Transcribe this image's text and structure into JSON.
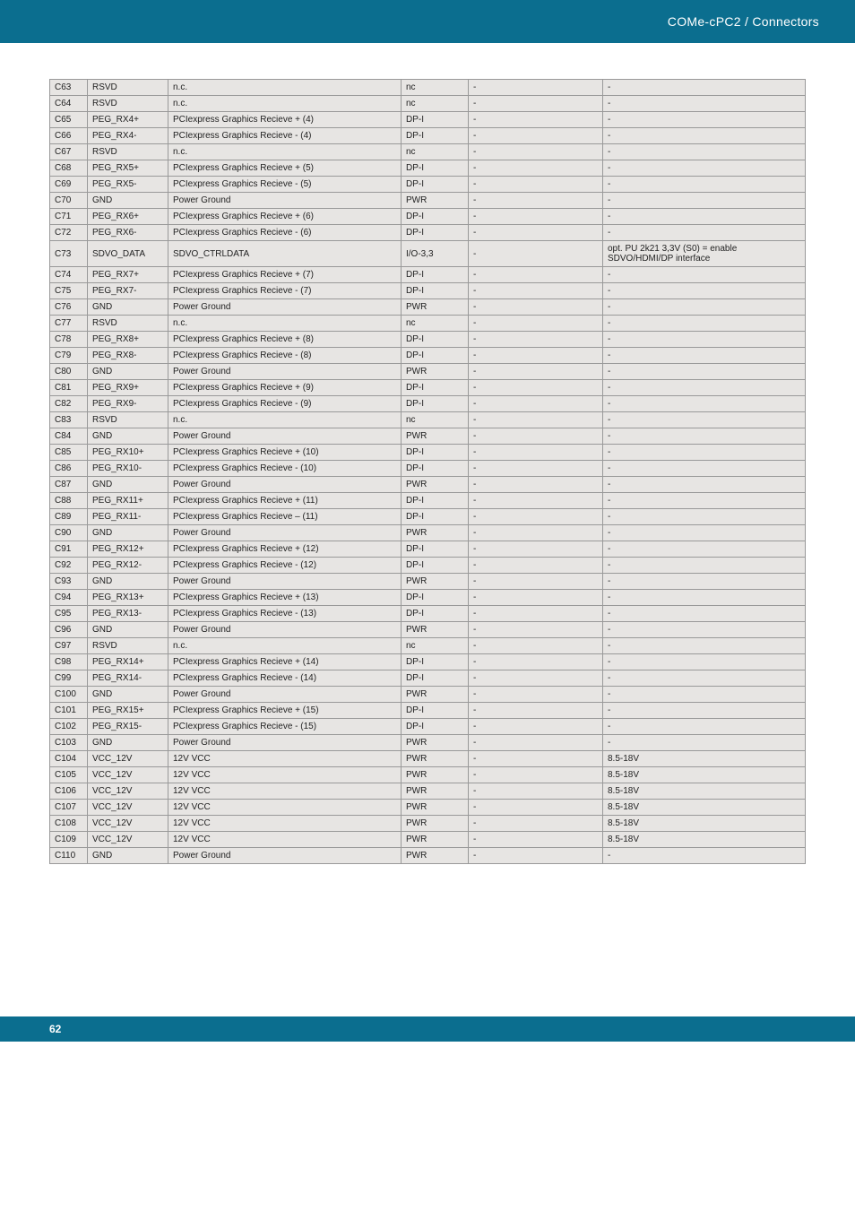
{
  "header": {
    "breadcrumb": "COMe-cPC2 / Connectors"
  },
  "footer": {
    "page": "62"
  },
  "table": {
    "rows": [
      {
        "pin": "C63",
        "signal": "RSVD",
        "desc": "n.c.",
        "type": "nc",
        "col5": "-",
        "col6": "-"
      },
      {
        "pin": "C64",
        "signal": "RSVD",
        "desc": "n.c.",
        "type": "nc",
        "col5": "-",
        "col6": "-"
      },
      {
        "pin": "C65",
        "signal": "PEG_RX4+",
        "desc": "PCIexpress Graphics Recieve + (4)",
        "type": "DP-I",
        "col5": "-",
        "col6": "-"
      },
      {
        "pin": "C66",
        "signal": "PEG_RX4-",
        "desc": "PCIexpress Graphics Recieve - (4)",
        "type": "DP-I",
        "col5": "-",
        "col6": "-"
      },
      {
        "pin": "C67",
        "signal": "RSVD",
        "desc": "n.c.",
        "type": "nc",
        "col5": "-",
        "col6": "-"
      },
      {
        "pin": "C68",
        "signal": "PEG_RX5+",
        "desc": "PCIexpress Graphics Recieve + (5)",
        "type": "DP-I",
        "col5": "-",
        "col6": "-"
      },
      {
        "pin": "C69",
        "signal": "PEG_RX5-",
        "desc": "PCIexpress Graphics Recieve - (5)",
        "type": "DP-I",
        "col5": "-",
        "col6": "-"
      },
      {
        "pin": "C70",
        "signal": "GND",
        "desc": "Power Ground",
        "type": "PWR",
        "col5": "-",
        "col6": "-"
      },
      {
        "pin": "C71",
        "signal": "PEG_RX6+",
        "desc": "PCIexpress Graphics Recieve + (6)",
        "type": "DP-I",
        "col5": "-",
        "col6": "-"
      },
      {
        "pin": "C72",
        "signal": "PEG_RX6-",
        "desc": "PCIexpress Graphics Recieve - (6)",
        "type": "DP-I",
        "col5": "-",
        "col6": "-"
      },
      {
        "pin": "C73",
        "signal": "SDVO_DATA",
        "desc": "SDVO_CTRLDATA",
        "type": "I/O-3,3",
        "col5": "-",
        "col6": "opt. PU 2k21 3,3V (S0) = enable SDVO/HDMI/DP interface"
      },
      {
        "pin": "C74",
        "signal": "PEG_RX7+",
        "desc": "PCIexpress Graphics Recieve + (7)",
        "type": "DP-I",
        "col5": "-",
        "col6": "-"
      },
      {
        "pin": "C75",
        "signal": "PEG_RX7-",
        "desc": "PCIexpress Graphics Recieve - (7)",
        "type": "DP-I",
        "col5": "-",
        "col6": "-"
      },
      {
        "pin": "C76",
        "signal": "GND",
        "desc": "Power Ground",
        "type": "PWR",
        "col5": "-",
        "col6": "-"
      },
      {
        "pin": "C77",
        "signal": "RSVD",
        "desc": "n.c.",
        "type": "nc",
        "col5": "-",
        "col6": "-"
      },
      {
        "pin": "C78",
        "signal": "PEG_RX8+",
        "desc": "PCIexpress Graphics Recieve + (8)",
        "type": "DP-I",
        "col5": "-",
        "col6": "-"
      },
      {
        "pin": "C79",
        "signal": "PEG_RX8-",
        "desc": "PCIexpress Graphics Recieve - (8)",
        "type": "DP-I",
        "col5": "-",
        "col6": "-"
      },
      {
        "pin": "C80",
        "signal": "GND",
        "desc": "Power Ground",
        "type": "PWR",
        "col5": "-",
        "col6": "-"
      },
      {
        "pin": "C81",
        "signal": "PEG_RX9+",
        "desc": "PCIexpress Graphics Recieve + (9)",
        "type": "DP-I",
        "col5": "-",
        "col6": "-"
      },
      {
        "pin": "C82",
        "signal": "PEG_RX9-",
        "desc": "PCIexpress Graphics Recieve - (9)",
        "type": "DP-I",
        "col5": "-",
        "col6": "-"
      },
      {
        "pin": "C83",
        "signal": "RSVD",
        "desc": "n.c.",
        "type": "nc",
        "col5": "-",
        "col6": "-"
      },
      {
        "pin": "C84",
        "signal": "GND",
        "desc": "Power Ground",
        "type": "PWR",
        "col5": "-",
        "col6": "-"
      },
      {
        "pin": "C85",
        "signal": "PEG_RX10+",
        "desc": "PCIexpress Graphics Recieve + (10)",
        "type": "DP-I",
        "col5": "-",
        "col6": "-"
      },
      {
        "pin": "C86",
        "signal": "PEG_RX10-",
        "desc": "PCIexpress Graphics Recieve - (10)",
        "type": "DP-I",
        "col5": "-",
        "col6": "-"
      },
      {
        "pin": "C87",
        "signal": "GND",
        "desc": "Power Ground",
        "type": "PWR",
        "col5": "-",
        "col6": "-"
      },
      {
        "pin": "C88",
        "signal": "PEG_RX11+",
        "desc": "PCIexpress Graphics Recieve + (11)",
        "type": "DP-I",
        "col5": "-",
        "col6": "-"
      },
      {
        "pin": "C89",
        "signal": "PEG_RX11-",
        "desc": "PCIexpress Graphics Recieve – (11)",
        "type": "DP-I",
        "col5": "-",
        "col6": "-"
      },
      {
        "pin": "C90",
        "signal": "GND",
        "desc": "Power Ground",
        "type": "PWR",
        "col5": "-",
        "col6": "-"
      },
      {
        "pin": "C91",
        "signal": "PEG_RX12+",
        "desc": "PCIexpress Graphics Recieve + (12)",
        "type": "DP-I",
        "col5": "-",
        "col6": "-"
      },
      {
        "pin": "C92",
        "signal": "PEG_RX12-",
        "desc": "PCIexpress Graphics Recieve - (12)",
        "type": "DP-I",
        "col5": "-",
        "col6": "-"
      },
      {
        "pin": "C93",
        "signal": "GND",
        "desc": "Power Ground",
        "type": "PWR",
        "col5": "-",
        "col6": "-"
      },
      {
        "pin": "C94",
        "signal": "PEG_RX13+",
        "desc": "PCIexpress Graphics Recieve + (13)",
        "type": "DP-I",
        "col5": "-",
        "col6": "-"
      },
      {
        "pin": "C95",
        "signal": "PEG_RX13-",
        "desc": "PCIexpress Graphics Recieve - (13)",
        "type": "DP-I",
        "col5": "-",
        "col6": "-"
      },
      {
        "pin": "C96",
        "signal": "GND",
        "desc": "Power Ground",
        "type": "PWR",
        "col5": "-",
        "col6": "-"
      },
      {
        "pin": "C97",
        "signal": "RSVD",
        "desc": "n.c.",
        "type": "nc",
        "col5": "-",
        "col6": "-"
      },
      {
        "pin": "C98",
        "signal": "PEG_RX14+",
        "desc": "PCIexpress Graphics Recieve + (14)",
        "type": "DP-I",
        "col5": "-",
        "col6": "-"
      },
      {
        "pin": "C99",
        "signal": "PEG_RX14-",
        "desc": "PCIexpress Graphics Recieve - (14)",
        "type": "DP-I",
        "col5": "-",
        "col6": "-"
      },
      {
        "pin": "C100",
        "signal": "GND",
        "desc": "Power Ground",
        "type": "PWR",
        "col5": "-",
        "col6": "-"
      },
      {
        "pin": "C101",
        "signal": "PEG_RX15+",
        "desc": "PCIexpress Graphics Recieve + (15)",
        "type": "DP-I",
        "col5": "-",
        "col6": "-"
      },
      {
        "pin": "C102",
        "signal": "PEG_RX15-",
        "desc": "PCIexpress Graphics Recieve - (15)",
        "type": "DP-I",
        "col5": "-",
        "col6": "-"
      },
      {
        "pin": "C103",
        "signal": "GND",
        "desc": "Power Ground",
        "type": "PWR",
        "col5": "-",
        "col6": "-"
      },
      {
        "pin": "C104",
        "signal": "VCC_12V",
        "desc": "12V VCC",
        "type": "PWR",
        "col5": "-",
        "col6": "8.5-18V"
      },
      {
        "pin": "C105",
        "signal": "VCC_12V",
        "desc": "12V VCC",
        "type": "PWR",
        "col5": "-",
        "col6": "8.5-18V"
      },
      {
        "pin": "C106",
        "signal": "VCC_12V",
        "desc": "12V VCC",
        "type": "PWR",
        "col5": "-",
        "col6": "8.5-18V"
      },
      {
        "pin": "C107",
        "signal": "VCC_12V",
        "desc": "12V VCC",
        "type": "PWR",
        "col5": "-",
        "col6": "8.5-18V"
      },
      {
        "pin": "C108",
        "signal": "VCC_12V",
        "desc": "12V VCC",
        "type": "PWR",
        "col5": "-",
        "col6": "8.5-18V"
      },
      {
        "pin": "C109",
        "signal": "VCC_12V",
        "desc": "12V VCC",
        "type": "PWR",
        "col5": "-",
        "col6": "8.5-18V"
      },
      {
        "pin": "C110",
        "signal": "GND",
        "desc": "Power Ground",
        "type": "PWR",
        "col5": "-",
        "col6": "-"
      }
    ]
  }
}
